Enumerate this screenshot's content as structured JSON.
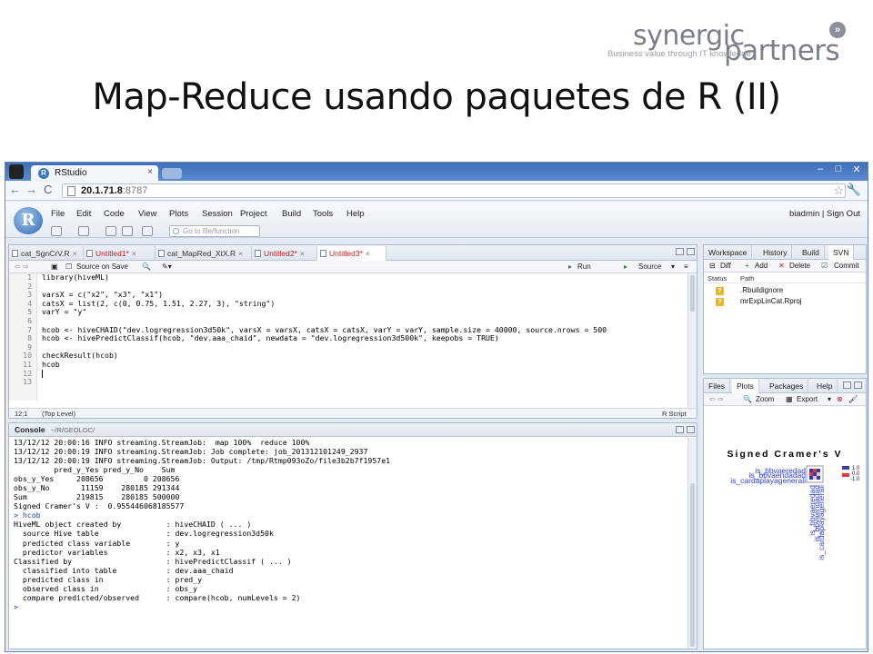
{
  "logo": {
    "word1": "synergic",
    "word2": "partners",
    "tagline": "Business value through IT knowledge",
    "chevron": "»"
  },
  "slide": {
    "title": "Map-Reduce usando paquetes de R (II)"
  },
  "browser": {
    "tab_title": "RStudio",
    "tab_close": "×",
    "url_host": "20.1.71.8",
    "url_port": ":8787",
    "back": "←",
    "forward": "→",
    "reload": "C",
    "star": "☆",
    "wrench": "🔧",
    "min": "–",
    "max": "□",
    "close": "✕"
  },
  "rstudio": {
    "menu": [
      "File",
      "Edit",
      "Code",
      "View",
      "Plots",
      "Session",
      "Project",
      "Build",
      "Tools",
      "Help"
    ],
    "user": "biadmin",
    "sign_out": "Sign Out",
    "separator": "|",
    "goto_placeholder": "Go to file/function",
    "logo_letter": "R"
  },
  "editor": {
    "tabs": [
      {
        "label": "cat_SgnCrV.R",
        "modified": false
      },
      {
        "label": "Untitled1*",
        "modified": true
      },
      {
        "label": "cat_MapRed_XtX.R",
        "modified": false
      },
      {
        "label": "Untitled2*",
        "modified": true
      },
      {
        "label": "Untitled3*",
        "modified": true
      }
    ],
    "source_on_save": "Source on Save",
    "run": "Run",
    "source": "Source",
    "lines": [
      "library(hiveML)",
      "",
      "varsX = c(\"x2\", \"x3\", \"x1\")",
      "catsX = list(2, c(0, 0.75, 1.51, 2.27, 3), \"string\")",
      "varY = \"y\"",
      "",
      "hcob <- hiveCHAID(\"dev.logregression3d50k\", varsX = varsX, catsX = catsX, varY = varY, sample.size = 40000, source.nrows = 500",
      "hcob <- hivePredictClassif(hcob, \"dev.aaa_chaid\", newdata = \"dev.logregression3d500k\", keepobs = TRUE)",
      "",
      "checkResult(hcob)",
      "hcob",
      "",
      ""
    ],
    "line_numbers": [
      "1",
      "2",
      "3",
      "4",
      "5",
      "6",
      "7",
      "8",
      "9",
      "10",
      "11",
      "12",
      "13"
    ],
    "status_pos": "12:1",
    "status_scope": "(Top Level)",
    "status_type": "R Script"
  },
  "console": {
    "title": "Console",
    "path": "~/R/GEOLOC/",
    "lines": [
      "13/12/12 20:00:16 INFO streaming.StreamJob:  map 100%  reduce 100%",
      "13/12/12 20:00:19 INFO streaming.StreamJob: Job complete: job_201312101249_2937",
      "13/12/12 20:00:19 INFO streaming.StreamJob: Output: /tmp/Rtmp093oZo/file3b2b7f1957e1",
      "",
      "         pred_y_Yes pred_y_No    Sum",
      "obs_y_Yes     208656         0 208656",
      "obs_y_No       11159    280185 291344",
      "Sum           219815    280185 500000",
      "",
      "Signed Cramer's V :  0.955446068185577",
      "> hcob",
      "HiveML object created by          : hiveCHAID ( ... )",
      "  source Hive table               : dev.logregression3d50k",
      "  predicted class variable        : y",
      "  predictor variables             : x2, x3, x1",
      "Classified by                     : hivePredictClassif ( ... )",
      "  classified into table           : dev.aaa_chaid",
      "  predicted class in              : pred_y",
      "  observed class in               : obs_y",
      "  compare predicted/observed      : compare(hcob, numLevels = 2)",
      ">"
    ]
  },
  "env_pane": {
    "tabs": [
      "Workspace",
      "History",
      "Build",
      "SVN"
    ],
    "toolbar": [
      "Diff",
      "Add",
      "Delete",
      "Commit"
    ],
    "col_status": "Status",
    "col_path": "Path",
    "files": [
      ".Rbuildignore",
      "mrExpLinCat.Rproj"
    ],
    "status_symbol": "?"
  },
  "plots_pane": {
    "tabs": [
      "Files",
      "Plots",
      "Packages",
      "Help"
    ],
    "zoom": "Zoom",
    "export": "Export",
    "plot_title": "Signed Cramer's V",
    "legend_ticks": [
      "1.0",
      "0.0",
      "-1.0"
    ],
    "row_labels_overlap": [
      "is_bbvaeredad",
      "is_bbvaendadad",
      "is_cardaplayagenerali"
    ],
    "col_labels_overlap": [
      "is_bbvaeredad",
      "is_bbvaendadad",
      "is_cardaplayagenerali"
    ]
  },
  "colors": {
    "accent_blue": "#3e6fb8",
    "plot_label_blue": "#2b3fd1",
    "modified_red": "#c02020"
  }
}
